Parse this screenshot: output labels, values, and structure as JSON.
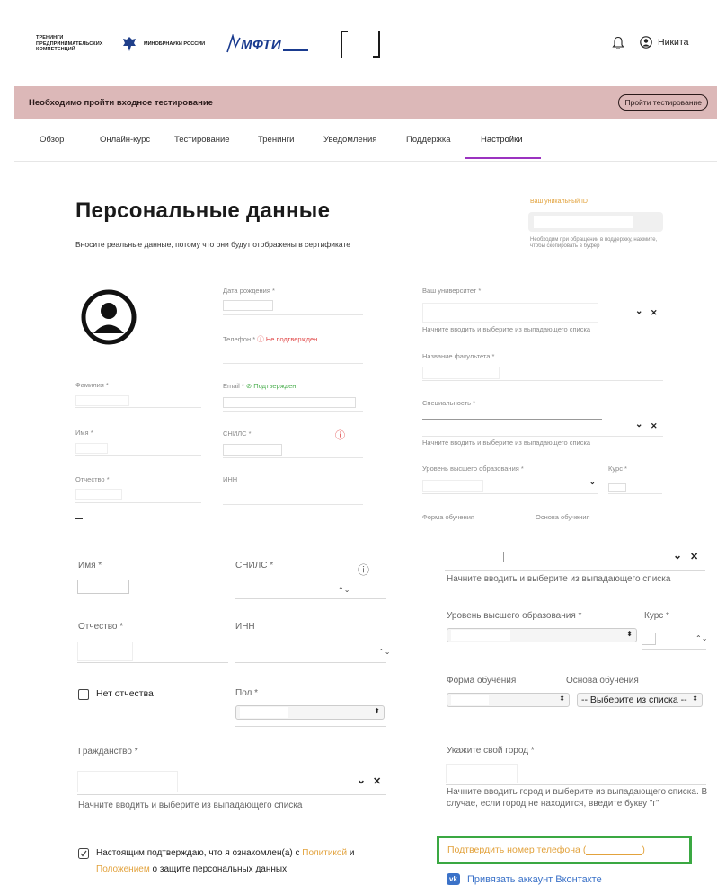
{
  "header": {
    "logo_trening": "ТРЕНИНГИ ПРЕДПРИНИМАТЕЛЬСКИХ КОМПЕТЕНЦИЙ",
    "logo_minobr": "МИНОБРНАУКИ РОССИИ",
    "logo_mfti": "МФТИ",
    "user_name": "Никита",
    "bell_icon": "bell-icon",
    "user_icon": "user-circle-icon"
  },
  "banner": {
    "text": "Необходимо пройти входное тестирование",
    "button": "Пройти тестирование",
    "color": "#dcb8b8"
  },
  "nav": {
    "items": [
      "Обзор",
      "Онлайн-курс",
      "Тестирование",
      "Тренинги",
      "Уведомления",
      "Поддержка",
      "Настройки"
    ],
    "active": "Настройки",
    "active_color": "#9b33c0"
  },
  "personal": {
    "title": "Персональные данные",
    "subtitle": "Вносите реальные данные, потому что они будут отображены в сертификате",
    "uid_label": "Ваш уникальный ID",
    "uid_help": "Необходим при обращении в поддержку, нажмите, чтобы скопировать в буфер"
  },
  "form1": {
    "birth_label": "Дата рождения *",
    "phone_label": "Телефон *",
    "phone_status": "Не подтвержден",
    "email_label": "Email *",
    "email_status": "Подтвержден",
    "surname_label": "Фамилия *",
    "name_label": "Имя *",
    "snils_label": "СНИЛС *",
    "patronymic_label": "Отчество *",
    "inn_label": "ИНН",
    "univ_label": "Ваш университет *",
    "univ_hint": "Начните вводить и выберите из выпадающего списка",
    "faculty_label": "Название факультета *",
    "spec_label": "Специальность *",
    "spec_hint": "Начните вводить и выберите из выпадающего списка",
    "edu_level_label": "Уровень высшего образования *",
    "course_label": "Курс *",
    "study_form_label": "Форма обучения",
    "study_basis_label": "Основа обучения"
  },
  "form2": {
    "name_label": "Имя *",
    "snils_label": "СНИЛС *",
    "patronymic_label": "Отчество *",
    "inn_label": "ИНН",
    "no_patronymic": "Нет отчества",
    "gender_label": "Пол *",
    "citizenship_label": "Гражданство *",
    "citizenship_hint": "Начните вводить и выберите из выпадающего списка",
    "consent_prefix": "Настоящим подтверждаю, что я ознакомлен(а) с",
    "consent_policy": "Политикой",
    "consent_and": "и",
    "consent_regulation": "Положением",
    "consent_suffix": "о защите персональных данных.",
    "univ_hint": "Начните вводить и выберите из выпадающего списка",
    "edu_level_label": "Уровень высшего образования *",
    "course_label": "Курс *",
    "study_form_label": "Форма обучения",
    "study_basis_label": "Основа обучения",
    "study_basis_value": "-- Выберите из списка --",
    "city_label": "Укажите свой город *",
    "city_hint_1": "Начните вводить город и выберите из выпадающего списка. В",
    "city_hint_2": "случае, если город не находится, введите букву \"г\"",
    "confirm_phone": "Подтвердить номер телефона (",
    "confirm_phone_end": ")",
    "vk_link": "Привязать аккаунт Вконтакте",
    "accent_orange": "#e2a23c",
    "highlight_green": "#3aa842"
  }
}
